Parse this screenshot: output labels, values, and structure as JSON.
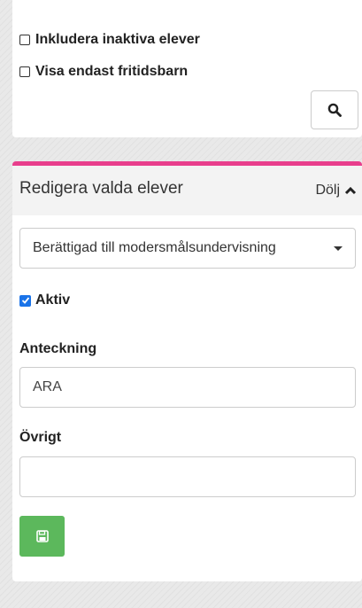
{
  "filters": {
    "include_inactive_label": "Inkludera inaktiva elever",
    "only_afterschool_label": "Visa endast fritidsbarn"
  },
  "edit_panel": {
    "title": "Redigera valda elever",
    "toggle_label": "Dölj",
    "select_value": "Berättigad till modersmålsundervisning",
    "active_label": "Aktiv",
    "note_label": "Anteckning",
    "note_value": "ARA",
    "other_label": "Övrigt",
    "other_value": ""
  },
  "colors": {
    "accent": "#e83e8c",
    "save_button": "#5cb85c",
    "checkbox": "#1a73e8"
  },
  "icons": {
    "search": "search-icon",
    "toggle": "chevron-up-icon",
    "save": "floppy-disk-icon",
    "dropdown": "caret-down-icon"
  }
}
